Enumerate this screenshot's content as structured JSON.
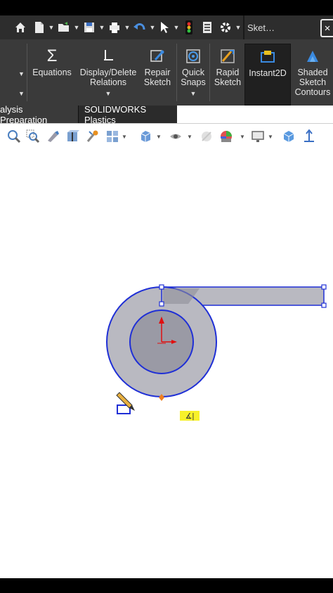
{
  "quick_access": {
    "icons": [
      "home-icon",
      "new-document-icon",
      "open-icon",
      "save-icon",
      "print-icon",
      "undo-icon",
      "select-icon",
      "traffic-light-icon",
      "file-properties-icon",
      "options-gear-icon"
    ],
    "sketch_tab_label": "Sket…",
    "close_label": "×"
  },
  "ribbon": {
    "buttons": [
      {
        "label": "Equations"
      },
      {
        "label": "Display/Delete Relations"
      },
      {
        "label": "Repair Sketch"
      },
      {
        "label": "Quick Snaps"
      },
      {
        "label": "Rapid Sketch"
      },
      {
        "label": "Instant2D"
      },
      {
        "label": "Shaded Sketch Contours"
      }
    ]
  },
  "tabs": [
    {
      "label": "alysis Preparation"
    },
    {
      "label": "SOLIDWORKS Plastics"
    }
  ],
  "heads_up_toolbar": {
    "icons": [
      "zoom-to-fit-icon",
      "zoom-to-area-icon",
      "previous-view-icon",
      "section-view-icon",
      "view-features-icon",
      "view-orientation-icon",
      "display-style-icon",
      "hide-show-items-icon",
      "edit-appearance-icon",
      "apply-scene-icon",
      "view-settings-icon",
      "display-pane-icon",
      "triad-icon"
    ]
  },
  "sketch": {
    "relation_badge": "∡|",
    "colors": {
      "line": "#1f2fd6",
      "fill": "#b9b9c1",
      "inner_fill": "#9a9aa5",
      "origin": "#e01010",
      "point": "#ffffff",
      "selected_point": "#f07f20"
    }
  }
}
